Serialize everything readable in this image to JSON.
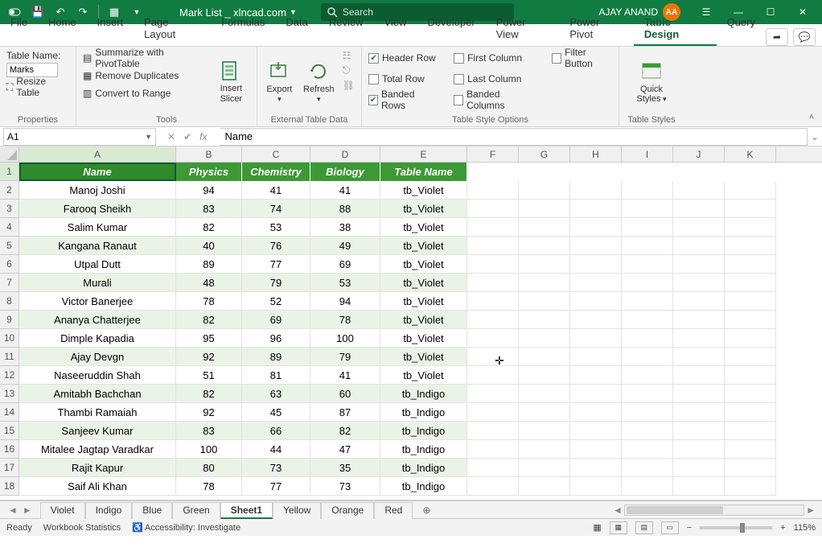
{
  "titlebar": {
    "doc_title": "Mark List _ xlncad.com",
    "search_placeholder": "Search",
    "user_name": "AJAY ANAND",
    "user_initials": "AA"
  },
  "menu": {
    "tabs": [
      "File",
      "Home",
      "Insert",
      "Page Layout",
      "Formulas",
      "Data",
      "Review",
      "View",
      "Developer",
      "Power View",
      "Power Pivot",
      "Table Design",
      "Query"
    ],
    "active_index": 11
  },
  "ribbon": {
    "properties": {
      "label": "Properties",
      "table_name_label": "Table Name:",
      "table_name_value": "Marks",
      "resize_label": "Resize Table"
    },
    "tools": {
      "label": "Tools",
      "summarize": "Summarize with PivotTable",
      "remove_dupes": "Remove Duplicates",
      "convert": "Convert to Range",
      "insert_slicer": "Insert Slicer"
    },
    "external": {
      "label": "External Table Data",
      "export": "Export",
      "refresh": "Refresh"
    },
    "style_opts": {
      "label": "Table Style Options",
      "header_row": "Header Row",
      "total_row": "Total Row",
      "banded_rows": "Banded Rows",
      "first_col": "First Column",
      "last_col": "Last Column",
      "banded_cols": "Banded Columns",
      "filter_btn": "Filter Button"
    },
    "styles": {
      "label": "Table Styles",
      "quick_styles": "Quick Styles"
    }
  },
  "fx": {
    "name_box": "A1",
    "formula": "Name"
  },
  "grid": {
    "col_letters": [
      "A",
      "B",
      "C",
      "D",
      "E",
      "F",
      "G",
      "H",
      "I",
      "J",
      "K"
    ],
    "headers": [
      "Name",
      "Physics",
      "Chemistry",
      "Biology",
      "Table Name"
    ],
    "rows": [
      {
        "n": "Manoj Joshi",
        "p": 94,
        "c": 41,
        "b": 41,
        "t": "tb_Violet"
      },
      {
        "n": "Farooq Sheikh",
        "p": 83,
        "c": 74,
        "b": 88,
        "t": "tb_Violet"
      },
      {
        "n": "Salim Kumar",
        "p": 82,
        "c": 53,
        "b": 38,
        "t": "tb_Violet"
      },
      {
        "n": "Kangana Ranaut",
        "p": 40,
        "c": 76,
        "b": 49,
        "t": "tb_Violet"
      },
      {
        "n": "Utpal Dutt",
        "p": 89,
        "c": 77,
        "b": 69,
        "t": "tb_Violet"
      },
      {
        "n": "Murali",
        "p": 48,
        "c": 79,
        "b": 53,
        "t": "tb_Violet"
      },
      {
        "n": "Victor Banerjee",
        "p": 78,
        "c": 52,
        "b": 94,
        "t": "tb_Violet"
      },
      {
        "n": "Ananya Chatterjee",
        "p": 82,
        "c": 69,
        "b": 78,
        "t": "tb_Violet"
      },
      {
        "n": "Dimple Kapadia",
        "p": 95,
        "c": 96,
        "b": 100,
        "t": "tb_Violet"
      },
      {
        "n": "Ajay Devgn",
        "p": 92,
        "c": 89,
        "b": 79,
        "t": "tb_Violet"
      },
      {
        "n": "Naseeruddin Shah",
        "p": 51,
        "c": 81,
        "b": 41,
        "t": "tb_Violet"
      },
      {
        "n": "Amitabh Bachchan",
        "p": 82,
        "c": 63,
        "b": 60,
        "t": "tb_Indigo"
      },
      {
        "n": "Thambi Ramaiah",
        "p": 92,
        "c": 45,
        "b": 87,
        "t": "tb_Indigo"
      },
      {
        "n": "Sanjeev Kumar",
        "p": 83,
        "c": 66,
        "b": 82,
        "t": "tb_Indigo"
      },
      {
        "n": "Mitalee Jagtap Varadkar",
        "p": 100,
        "c": 44,
        "b": 47,
        "t": "tb_Indigo"
      },
      {
        "n": "Rajit Kapur",
        "p": 80,
        "c": 73,
        "b": 35,
        "t": "tb_Indigo"
      },
      {
        "n": "Saif Ali Khan",
        "p": 78,
        "c": 77,
        "b": 73,
        "t": "tb_Indigo"
      }
    ]
  },
  "sheets": {
    "tabs": [
      "Violet",
      "Indigo",
      "Blue",
      "Green",
      "Sheet1",
      "Yellow",
      "Orange",
      "Red"
    ],
    "active_index": 4
  },
  "status": {
    "ready": "Ready",
    "wb_stats": "Workbook Statistics",
    "accessibility": "Accessibility: Investigate",
    "zoom": "115%"
  }
}
